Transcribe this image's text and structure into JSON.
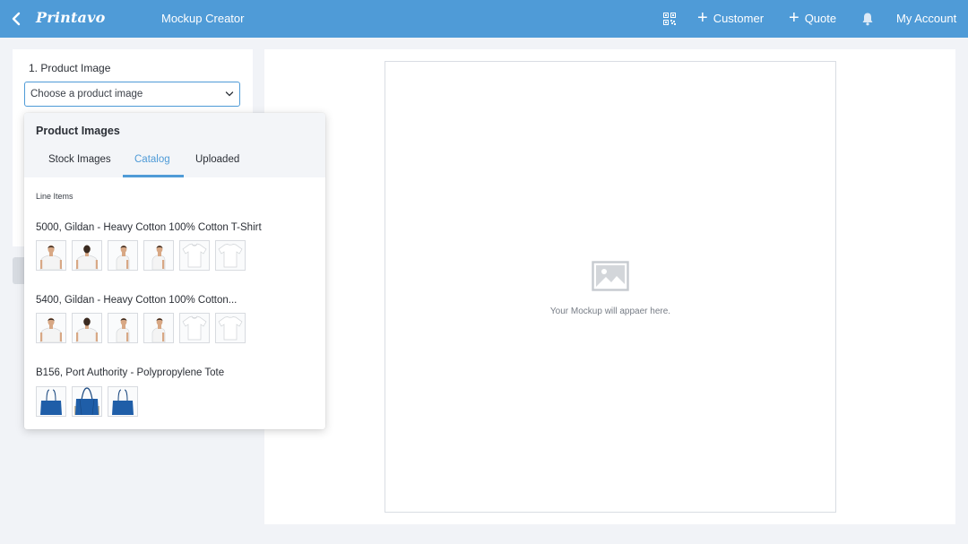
{
  "header": {
    "logo": "Printavo",
    "title": "Mockup Creator",
    "customer_label": "Customer",
    "quote_label": "Quote",
    "account_label": "My Account"
  },
  "sidebar": {
    "section_label": "1. Product Image",
    "select_value": "Choose a product image"
  },
  "popover": {
    "title": "Product Images",
    "tabs": [
      {
        "label": "Stock Images",
        "active": false
      },
      {
        "label": "Catalog",
        "active": true
      },
      {
        "label": "Uploaded",
        "active": false
      }
    ],
    "subhead": "Line Items",
    "items": [
      {
        "title": "5000, Gildan - Heavy Cotton 100% Cotton T-Shirt",
        "thumbs": [
          "model-front",
          "model-back",
          "model-side",
          "model-side",
          "shirt-front",
          "shirt-back"
        ]
      },
      {
        "title": "5400, Gildan - Heavy Cotton 100% Cotton...",
        "thumbs": [
          "model-front",
          "model-back",
          "model-side",
          "model-side",
          "shirt-front",
          "shirt-back"
        ]
      },
      {
        "title": "B156, Port Authority - Polypropylene Tote",
        "thumbs": [
          "tote",
          "tote-model",
          "tote"
        ]
      }
    ]
  },
  "canvas": {
    "placeholder": "Your Mockup will appaer here."
  },
  "colors": {
    "brand": "#4f9bd7",
    "tote": "#1f5ea8"
  },
  "icons": {
    "back": "chevron-left-icon",
    "qr": "qr-code-icon",
    "plus": "plus-icon",
    "bell": "bell-icon",
    "dropdown": "chevron-down-icon",
    "image": "image-placeholder-icon"
  }
}
